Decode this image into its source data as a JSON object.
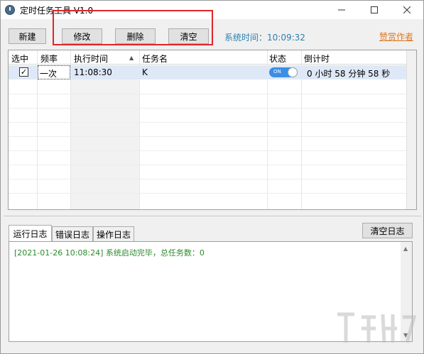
{
  "window": {
    "title": "定时任务工具 V1.0"
  },
  "toolbar": {
    "new_label": "新建",
    "edit_label": "修改",
    "delete_label": "删除",
    "clear_label": "清空",
    "system_time_label": "系统时间：",
    "system_time_value": "10:09:32",
    "donate_label": "赞赏作者"
  },
  "grid": {
    "headers": [
      "选中",
      "频率",
      "执行时间",
      "任务名",
      "状态",
      "倒计时"
    ],
    "rows": [
      {
        "checked": true,
        "frequency": "一次",
        "exec_time": "11:08:30",
        "task_name": "K",
        "status": "ON",
        "countdown": "0 小时 58 分钟 58 秒"
      }
    ]
  },
  "log": {
    "tabs": [
      "运行日志",
      "错误日志",
      "操作日志"
    ],
    "active_tab": 0,
    "clear_label": "清空日志",
    "lines": [
      "[2021-01-26 10:08:24] 系统启动完毕，总任务数：0"
    ]
  },
  "colors": {
    "accent": "#3a8ee6",
    "highlight_box": "#e0262a",
    "log_text": "#2a8a2a",
    "system_time": "#2b7fb0",
    "donate": "#e07820"
  }
}
